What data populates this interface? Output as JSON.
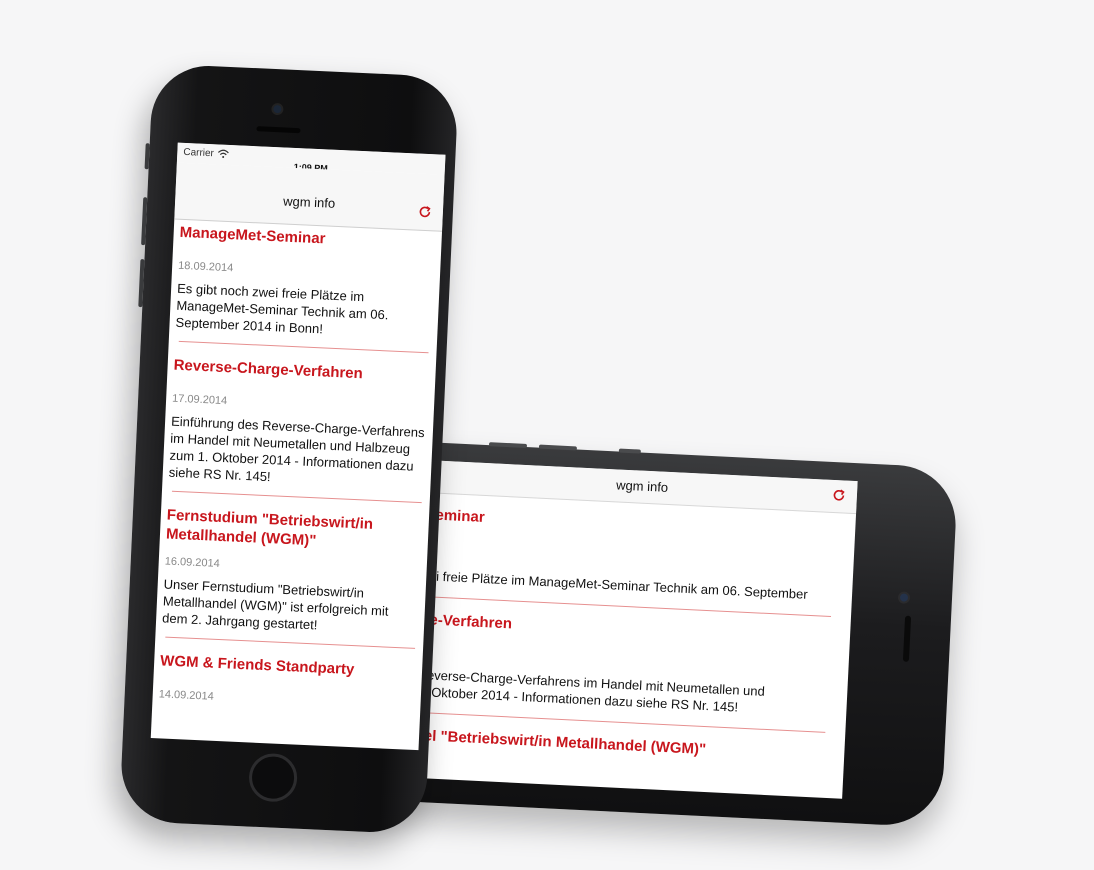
{
  "colors": {
    "accent_red": "#c8161d",
    "separator": "#e69090",
    "nav_bg": "#f7f7f7",
    "phone_body": "#1c1c1e"
  },
  "status_bar": {
    "carrier": "Carrier",
    "time": "1:09 PM",
    "wifi_icon": "wifi-icon",
    "battery_icon": "battery-icon"
  },
  "app": {
    "title": "wgm info",
    "refresh_icon": "refresh-icon"
  },
  "portrait": {
    "items": [
      {
        "title": "ManageMet-Seminar",
        "date": "18.09.2014",
        "text": "Es gibt noch zwei freie Plätze im ManageMet-Seminar Technik am 06. September 2014 in Bonn!"
      },
      {
        "title": "Reverse-Charge-Verfahren",
        "date": "17.09.2014",
        "text": "Einführung des Reverse-Charge-Verfahrens im Handel mit Neumetallen und Halbzeug zum 1. Oktober 2014 - Informationen dazu siehe RS Nr. 145!"
      },
      {
        "title": "Fernstudium \"Betriebswirt/in Metallhandel (WGM)\"",
        "date": "16.09.2014",
        "text": "Unser Fernstudium \"Betriebswirt/in Metallhandel (WGM)\" ist erfolgreich mit dem 2. Jahrgang gestartet!"
      },
      {
        "title": "WGM & Friends Standparty",
        "date": "14.09.2014",
        "text": ""
      }
    ]
  },
  "landscape": {
    "items": [
      {
        "title": "Seminar",
        "text": "vei freie Plätze im ManageMet-Seminar Technik am 06. September"
      },
      {
        "title": "ge-Verfahren",
        "text": "Reverse-Charge-Verfahrens im Handel mit Neumetallen und\n1. Oktober 2014 - Informationen dazu siehe RS Nr. 145!"
      },
      {
        "title": "del \"Betriebswirt/in Metallhandel (WGM)\"",
        "text": ""
      }
    ]
  }
}
